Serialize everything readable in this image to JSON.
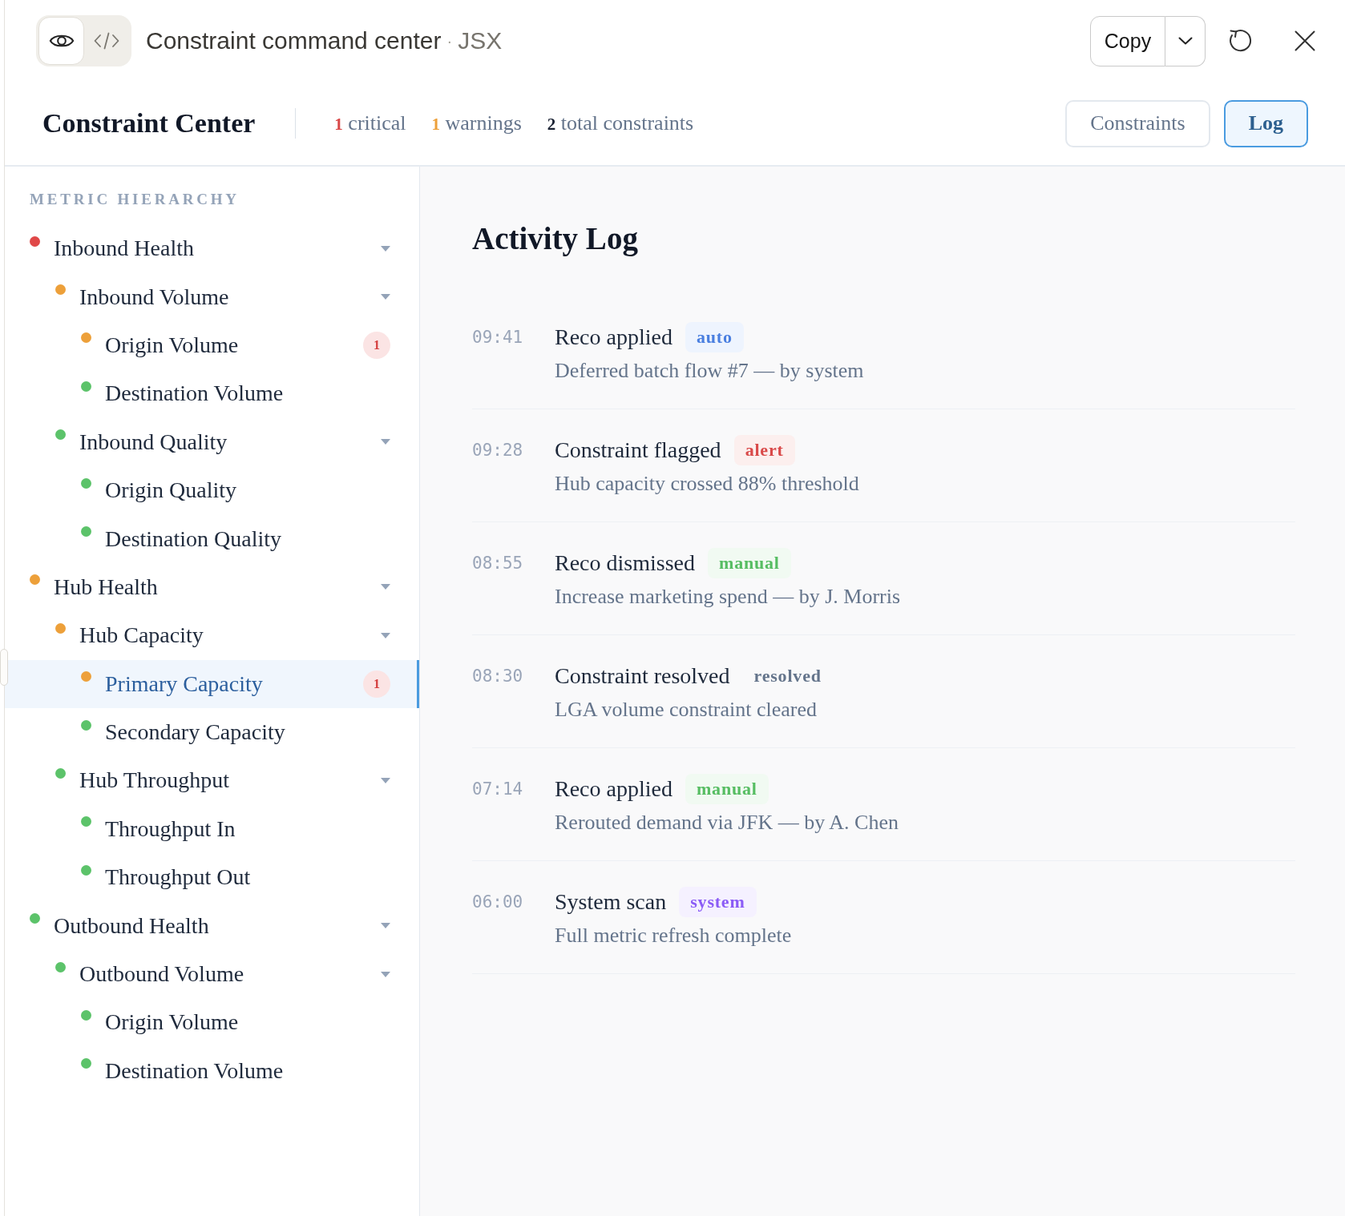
{
  "toolbar": {
    "view_toggle": [
      {
        "kind": "preview",
        "selected": true
      },
      {
        "kind": "code",
        "selected": false
      }
    ],
    "title": "Constraint command center",
    "separator": "·",
    "file_type": "JSX",
    "copy_label": "Copy"
  },
  "header": {
    "title": "Constraint Center",
    "stats": [
      {
        "text": "**1** critical",
        "color": "#d94848"
      },
      {
        "text": "**1** warnings",
        "color": "#eda03a"
      },
      {
        "text": "**2** total constraints",
        "color": "#1a2233"
      }
    ],
    "tabs": [
      {
        "label": "Constraints",
        "selected": false
      },
      {
        "label": "Log",
        "selected": true
      }
    ]
  },
  "sidebar": {
    "heading": "METRIC HIERARCHY",
    "items": [
      {
        "label": "Inbound Health",
        "color": "#e04848",
        "selected": false,
        "expanded": true,
        "children": [
          {
            "label": "Inbound Volume",
            "color": "#eda03a",
            "selected": false,
            "expanded": true,
            "children": [
              {
                "label": "Origin Volume",
                "color": "#eda03a",
                "selected": false,
                "badge": "1"
              },
              {
                "label": "Destination Volume",
                "color": "#5cc36a",
                "selected": false
              }
            ]
          },
          {
            "label": "Inbound Quality",
            "color": "#5cc36a",
            "selected": false,
            "expanded": true,
            "children": [
              {
                "label": "Origin Quality",
                "color": "#5cc36a",
                "selected": false
              },
              {
                "label": "Destination Quality",
                "color": "#5cc36a",
                "selected": false
              }
            ]
          }
        ]
      },
      {
        "label": "Hub Health",
        "color": "#eda03a",
        "selected": false,
        "expanded": true,
        "children": [
          {
            "label": "Hub Capacity",
            "color": "#eda03a",
            "selected": false,
            "expanded": true,
            "children": [
              {
                "label": "Primary Capacity",
                "color": "#eda03a",
                "selected": true,
                "badge": "1"
              },
              {
                "label": "Secondary Capacity",
                "color": "#5cc36a",
                "selected": false
              }
            ]
          },
          {
            "label": "Hub Throughput",
            "color": "#5cc36a",
            "selected": false,
            "expanded": true,
            "children": [
              {
                "label": "Throughput In",
                "color": "#5cc36a",
                "selected": false
              },
              {
                "label": "Throughput Out",
                "color": "#5cc36a",
                "selected": false
              }
            ]
          }
        ]
      },
      {
        "label": "Outbound Health",
        "color": "#5cc36a",
        "selected": false,
        "expanded": true,
        "children": [
          {
            "label": "Outbound Volume",
            "color": "#5cc36a",
            "selected": false,
            "expanded": true,
            "children": [
              {
                "label": "Origin Volume",
                "color": "#5cc36a",
                "selected": false
              },
              {
                "label": "Destination Volume",
                "color": "#5cc36a",
                "selected": false
              }
            ]
          }
        ]
      }
    ]
  },
  "main": {
    "title": "Activity Log",
    "entries": [
      {
        "time": "09:41",
        "title": "Reco applied",
        "tag": "auto",
        "kind": "auto",
        "description": "Deferred batch flow #7 — by system"
      },
      {
        "time": "09:28",
        "title": "Constraint flagged",
        "tag": "alert",
        "kind": "alert",
        "description": "Hub capacity crossed 88% threshold"
      },
      {
        "time": "08:55",
        "title": "Reco dismissed",
        "tag": "manual",
        "kind": "manual",
        "description": "Increase marketing spend — by J. Morris"
      },
      {
        "time": "08:30",
        "title": "Constraint resolved",
        "tag": "resolved",
        "kind": "resolved",
        "description": "LGA volume constraint cleared"
      },
      {
        "time": "07:14",
        "title": "Reco applied",
        "tag": "manual",
        "kind": "manual",
        "description": "Rerouted demand via JFK — by A. Chen"
      },
      {
        "time": "06:00",
        "title": "System scan",
        "tag": "system",
        "kind": "system",
        "description": "Full metric refresh complete"
      }
    ]
  }
}
